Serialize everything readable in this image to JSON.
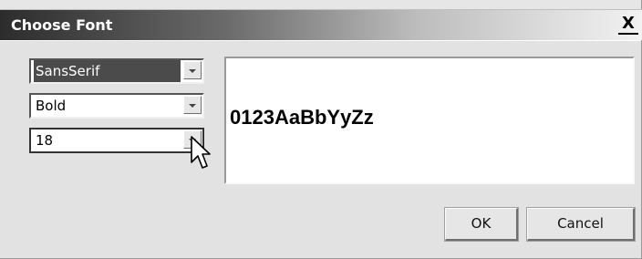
{
  "dialog": {
    "title": "Choose Font",
    "close_label": "X"
  },
  "font_family": {
    "value": "SansSerif"
  },
  "font_style": {
    "value": "Bold"
  },
  "font_size": {
    "value": "18"
  },
  "preview": {
    "sample_text": "0123AaBbYyZz"
  },
  "buttons": {
    "ok_label": "OK",
    "cancel_label": "Cancel"
  }
}
